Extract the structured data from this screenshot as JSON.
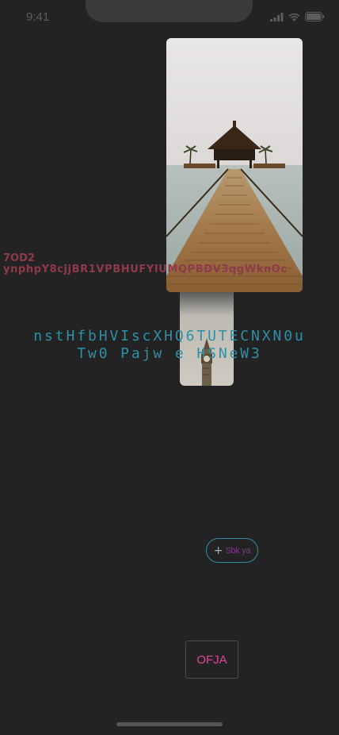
{
  "status_bar": {
    "time": "9:41",
    "signal_icon": "signal-icon",
    "wifi_icon": "wifi-icon",
    "battery_icon": "battery-icon"
  },
  "images": {
    "pier": "pier-photo",
    "clock_tower": "clock-tower-photo"
  },
  "red_text": {
    "line1": "7OD2",
    "line2": "ynphpY8cjjBR1VPBHUFYIUMQPBDV3qgWknOc"
  },
  "teal_text": {
    "line1": "nstHfbHVIscXHQ6TUTECNXN0u",
    "line2": "Tw0 Pajw e HSNeW3"
  },
  "pill_button": {
    "icon": "plus-icon",
    "label": "Sbk ya"
  },
  "square_button": {
    "label": "OFJA"
  },
  "colors": {
    "background": "#232323",
    "red_text": "#8e3a4a",
    "teal": "#2e8fa6",
    "pink": "#d9479b",
    "purple": "#7a3a8a"
  }
}
